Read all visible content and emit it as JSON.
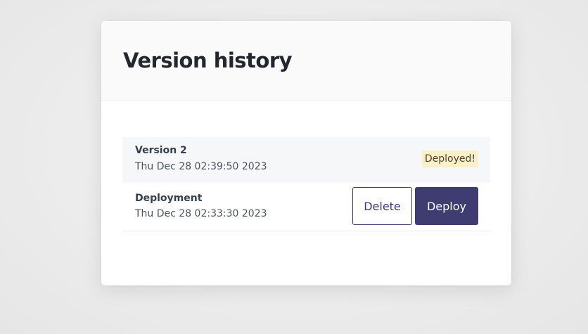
{
  "modal": {
    "title": "Version history"
  },
  "versions": [
    {
      "name": "Version 2",
      "date": "Thu Dec 28 02:39:50 2023",
      "status": "Deployed!"
    },
    {
      "name": "Deployment",
      "date": "Thu Dec 28 02:33:30 2023",
      "delete_label": "Delete",
      "deploy_label": "Deploy"
    }
  ],
  "colors": {
    "primary": "#3f3c72",
    "badge_bg": "#fbf0c7",
    "current_row_bg": "#f5f7f9"
  }
}
